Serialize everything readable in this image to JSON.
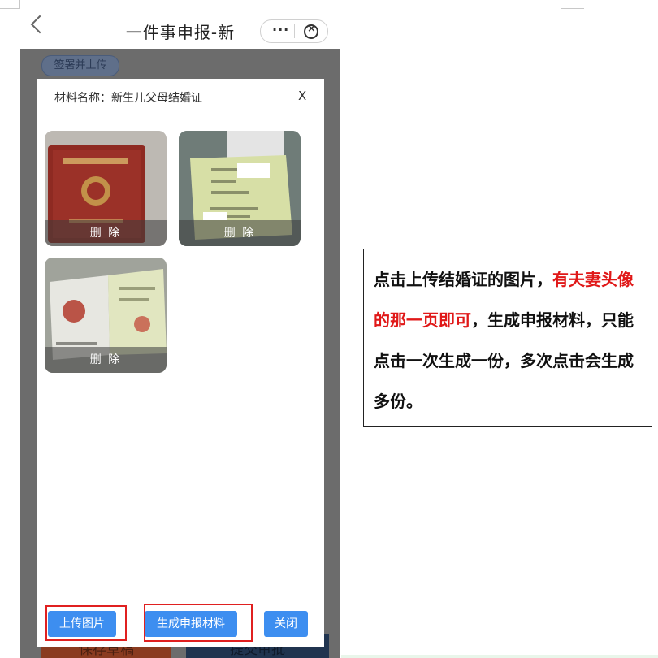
{
  "header": {
    "title": "一件事申报-新",
    "more_label": "···"
  },
  "page": {
    "sign_button": "签署并上传",
    "save_draft": "保存草稿",
    "submit_approval": "提交审批"
  },
  "modal": {
    "material_label": "材料名称：新生儿父母结婚证",
    "close_label": "X",
    "thumbnails": [
      {
        "delete_label": "删 除"
      },
      {
        "delete_label": "删 除"
      },
      {
        "delete_label": "删 除"
      }
    ],
    "buttons": {
      "upload": "上传图片",
      "generate": "生成申报材料",
      "close": "关闭"
    }
  },
  "callout": {
    "part1": "点击上传结婚证的图片，",
    "part2_red": "有夫妻头像的那一页即可",
    "part3": "，生成申报材料，只能点击一次生成一份，多次点击会生成多份。"
  },
  "colors": {
    "accent_button": "#3d8ef0",
    "highlight_box": "#e02020",
    "callout_red": "#e01818"
  }
}
